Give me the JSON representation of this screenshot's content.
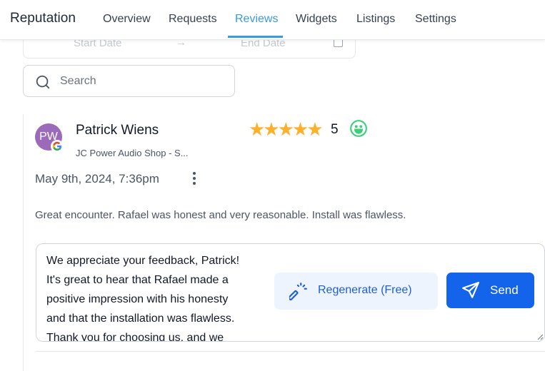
{
  "header": {
    "brand": "Reputation",
    "tabs": [
      {
        "label": "Overview",
        "active": false
      },
      {
        "label": "Requests",
        "active": false
      },
      {
        "label": "Reviews",
        "active": true
      },
      {
        "label": "Widgets",
        "active": false
      },
      {
        "label": "Listings",
        "active": false
      },
      {
        "label": "Settings",
        "active": false
      }
    ],
    "accent_color": "#3b9ad9"
  },
  "filters": {
    "start_date_placeholder": "Start Date",
    "arrow": "→",
    "end_date_placeholder": "End Date",
    "search_placeholder": "Search"
  },
  "review": {
    "avatar_initials": "PW",
    "source_icon": "google-icon",
    "reviewer_name": "Patrick Wiens",
    "location": "JC Power Audio Shop - S...",
    "stars_display": "★★★★★",
    "rating": "5",
    "sentiment_icon": "smile-icon",
    "date": "May 9th, 2024, 7:36pm",
    "text": "Great encounter. Rafael was honest and very reasonable. Install was flawless.",
    "reply_text": "We appreciate your feedback, Patrick!\nIt's great to hear that Rafael made a\npositive impression with his honesty\nand that the installation was flawless.\nThank you for choosing us, and we",
    "regenerate_label": "Regenerate (Free)",
    "send_label": "Send",
    "primary_color": "#1363eb"
  }
}
